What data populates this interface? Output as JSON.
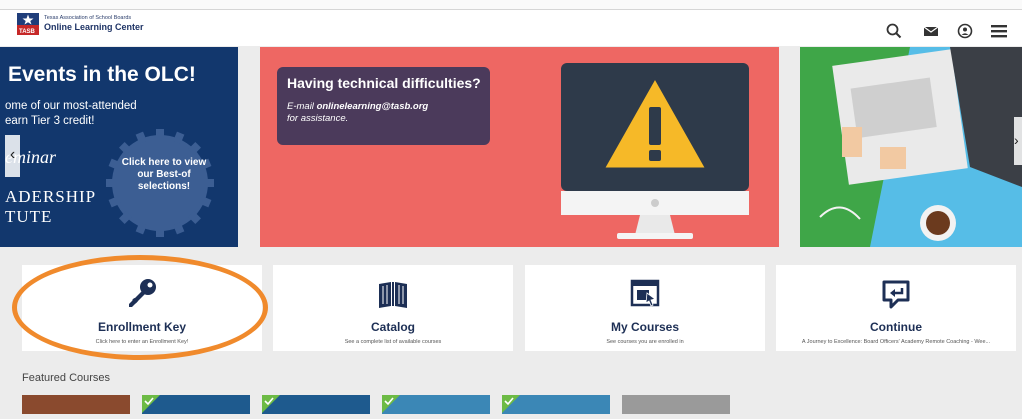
{
  "header": {
    "logo_small": "Texas Association of School Boards",
    "logo_big": "Online Learning Center",
    "icons": [
      "search-icon",
      "mail-icon",
      "user-icon",
      "menu-icon"
    ]
  },
  "carousel": {
    "left_slide": {
      "title": "Events in the OLC!",
      "subtitle_line1": "ome of our most-attended",
      "subtitle_line2": "earn Tier 3 credit!",
      "seminar": "eminar",
      "leadership_line1": "ADERSHIP",
      "leadership_line2": "TUTE",
      "badge_text": "Click here to view our Best-of selections!"
    },
    "middle_slide": {
      "title": "Having technical difficulties?",
      "email_prefix": "E-mail ",
      "email": "onlinelearning@tasb.org",
      "suffix": "for assistance."
    },
    "prev_arrow": "‹",
    "next_arrow": "›"
  },
  "cards": [
    {
      "title": "Enrollment Key",
      "subtitle": "Click here to enter an Enrollment Key!",
      "icon": "key-icon"
    },
    {
      "title": "Catalog",
      "subtitle": "See a complete list of available courses",
      "icon": "book-icon"
    },
    {
      "title": "My Courses",
      "subtitle": "See courses you are enrolled in",
      "icon": "courses-icon"
    },
    {
      "title": "Continue",
      "subtitle": "A Journey to Excellence: Board Officers' Academy Remote Coaching - Wee...",
      "icon": "continue-icon"
    }
  ],
  "featured": {
    "label": "Featured Courses"
  },
  "colors": {
    "navy": "#12376d",
    "coral": "#ee6763",
    "orange_highlight": "#f08a2c",
    "card_text": "#1d2f55"
  }
}
